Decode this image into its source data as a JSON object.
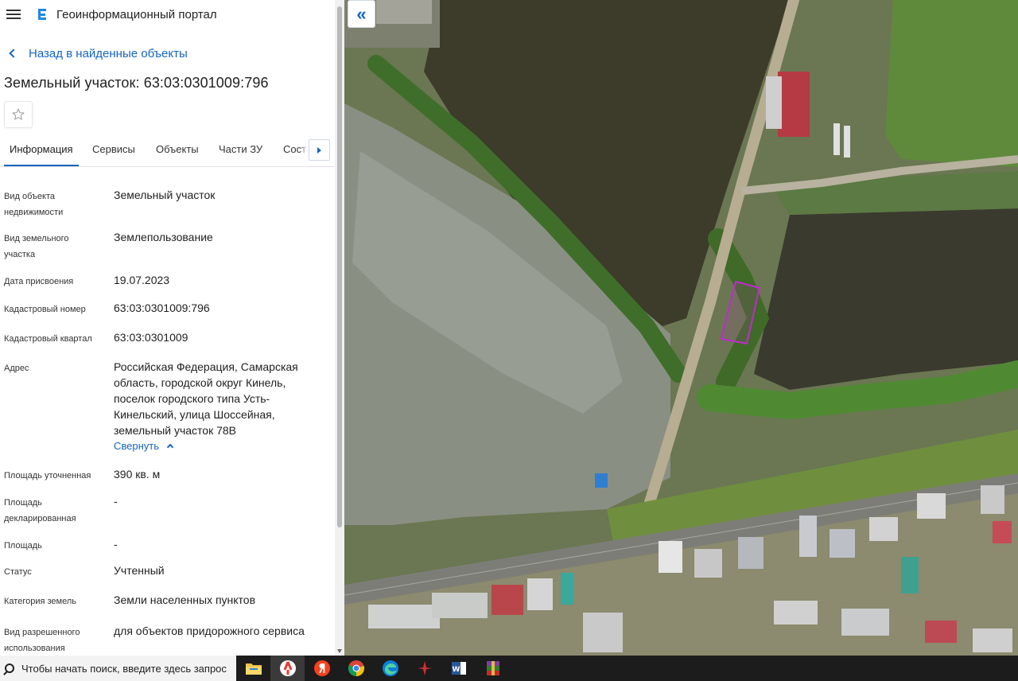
{
  "app": {
    "title": "Геоинформационный портал"
  },
  "nav": {
    "back_label": "Назад в найденные объекты"
  },
  "object": {
    "title": "Земельный участок: 63:03:0301009:796"
  },
  "tabs": [
    {
      "label": "Информация",
      "active": true
    },
    {
      "label": "Сервисы"
    },
    {
      "label": "Объекты"
    },
    {
      "label": "Части ЗУ"
    },
    {
      "label": "Соста"
    }
  ],
  "props": [
    {
      "label": "Вид объекта недвижимости",
      "value": "Земельный участок"
    },
    {
      "label": "Вид земельного участка",
      "value": "Землепользование"
    },
    {
      "label": "Дата присвоения",
      "value": "19.07.2023"
    },
    {
      "label": "Кадастровый номер",
      "value": "63:03:0301009:796"
    },
    {
      "label": "Кадастровый квартал",
      "value": "63:03:0301009"
    },
    {
      "label": "Адрес",
      "value": "Российская Федерация, Самарская область, городской округ Кинель, поселок городского типа Усть-Кинельский, улица Шоссейная, земельный участок 78В"
    },
    {
      "label": "Площадь уточненная",
      "value": "390 кв. м"
    },
    {
      "label": "Площадь декларированная",
      "value": "-"
    },
    {
      "label": "Площадь",
      "value": "-"
    },
    {
      "label": "Статус",
      "value": "Учтенный"
    },
    {
      "label": "Категория земель",
      "value": "Земли населенных пунктов"
    },
    {
      "label": "Вид разрешенного использования",
      "value": "для объектов придорожного сервиса"
    }
  ],
  "address_toggle": "Свернуть",
  "map": {
    "collapse_symbol": "«"
  },
  "taskbar": {
    "search_placeholder": "Чтобы начать поиск, введите здесь запрос",
    "apps": [
      "file-explorer",
      "yandex-browser",
      "yandex",
      "chrome",
      "edge",
      "app-red",
      "word",
      "winrar"
    ]
  }
}
